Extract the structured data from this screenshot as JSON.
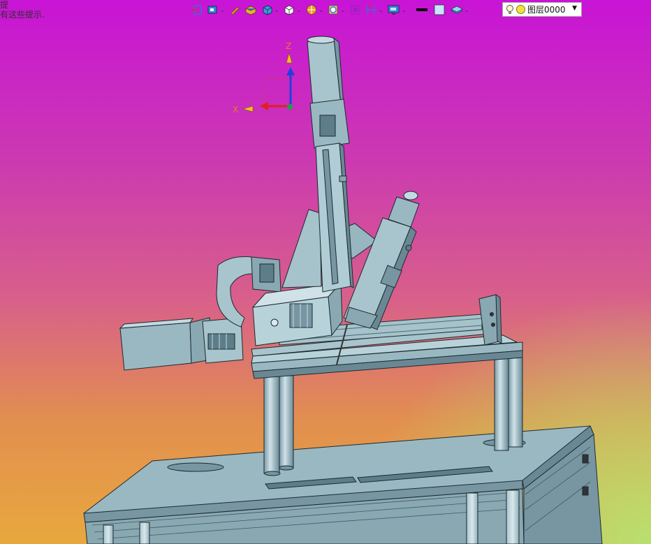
{
  "hint": {
    "line1": "提",
    "line2": "有这些提示."
  },
  "toolbar": {
    "buttons": [
      {
        "name": "select-filter-icon",
        "color": "#3a6fd0"
      },
      {
        "name": "view-orient-icon",
        "color": "#2b8ad8"
      },
      {
        "name": "sketch-pencil-icon",
        "color": "#e0a020"
      },
      {
        "name": "solid-box-icon",
        "color": "#2e7cd6"
      },
      {
        "name": "render-cube-icon",
        "color": "#3a9ae0"
      },
      {
        "name": "wire-cube-icon",
        "color": "#ffffff"
      },
      {
        "name": "section-view-icon",
        "color": "#f0a020"
      },
      {
        "name": "zoom-icon",
        "color": "#2b8ad8"
      },
      {
        "name": "fit-view-icon",
        "color": "#a020c0"
      },
      {
        "name": "measure-icon",
        "color": "#3a6fd0"
      },
      {
        "name": "display-screen-icon",
        "color": "#2b8ad8"
      },
      {
        "name": "line-color-icon",
        "color": "#000000"
      },
      {
        "name": "fill-color-icon",
        "color": "#c8e4ff"
      },
      {
        "name": "layer-stack-icon",
        "color": "#2eaad0"
      }
    ],
    "layer_label": "图层0000"
  },
  "axes": {
    "z_label": "Z",
    "x_label": "X"
  },
  "colors": {
    "model": "#8fb0bb",
    "model_dark": "#5d7d89",
    "model_light": "#c4dae0",
    "edge": "#1a2a30"
  }
}
